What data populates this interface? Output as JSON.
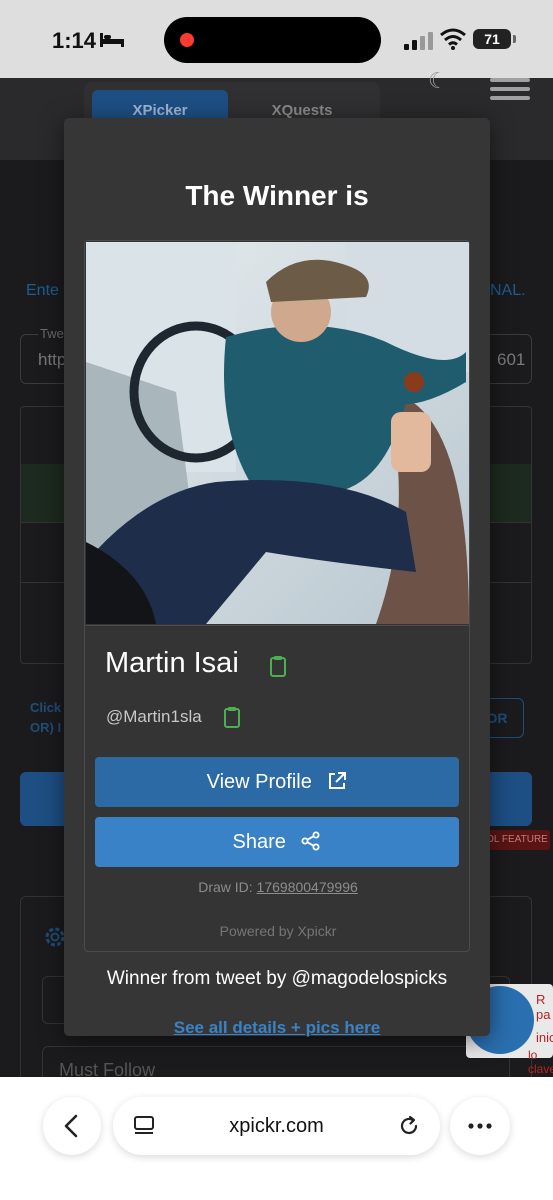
{
  "status_bar": {
    "time": "1:14",
    "battery": "71"
  },
  "background": {
    "tabs": [
      "XPicker",
      "XQuests"
    ],
    "intro_left": "Ente",
    "intro_right": "NAL.",
    "tweet_label": "Twe",
    "tweet_value_left": "http",
    "tweet_value_right": "601",
    "click_line1": "Click",
    "click_line2": "OR) I",
    "or_button": "OR",
    "feature_badge": "OL FEATURE",
    "must_follow": "Must Follow",
    "promo_line1": "R pa",
    "promo_line2": "inic",
    "promo_line3": "lo clave d"
  },
  "modal": {
    "title": "The Winner is",
    "winner_name": "Martin Isai",
    "winner_handle": "@Martin1sla",
    "view_profile": "View Profile",
    "share": "Share",
    "draw_id_label": "Draw ID:",
    "draw_id_value": "1769800479996",
    "powered_by": "Powered by Xpickr",
    "winner_from": "Winner from tweet by @magodelospicks",
    "see_all": "See all details + pics here"
  },
  "browser": {
    "url": "xpickr.com"
  },
  "colors": {
    "accent": "#3a82c7",
    "copy_icon": "#4caf50",
    "modal_bg": "#363636"
  }
}
